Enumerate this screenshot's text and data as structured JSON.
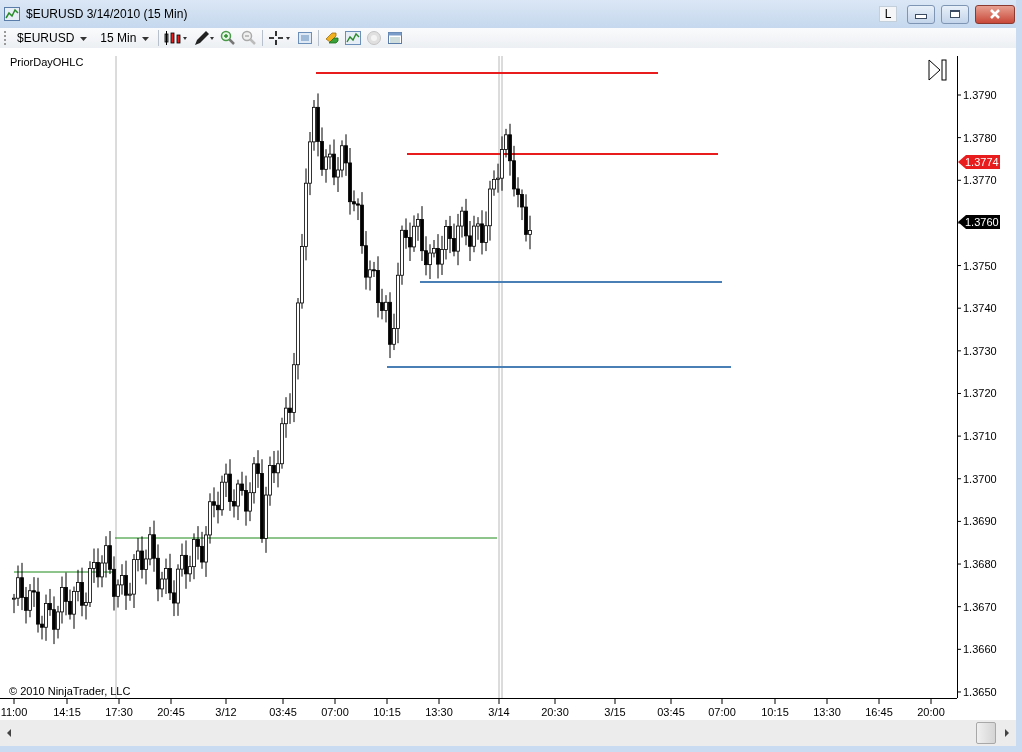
{
  "window": {
    "title": "$EURUSD  3/14/2010 (15 Min)",
    "buttons": [
      "L"
    ]
  },
  "toolbar": {
    "instrument": "$EURUSD",
    "interval": "15 Min"
  },
  "chart": {
    "indicator_label": "PriorDayOHLC",
    "copyright": "© 2010 NinjaTrader, LLC",
    "price_axis": [
      "1.3790",
      "1.3780",
      "1.3770",
      "1.3750",
      "1.3740",
      "1.3730",
      "1.3720",
      "1.3710",
      "1.3700",
      "1.3690",
      "1.3680",
      "1.3670",
      "1.3660",
      "1.3650"
    ],
    "time_axis": [
      "11:00",
      "14:15",
      "17:30",
      "20:45",
      "3/12",
      "03:45",
      "07:00",
      "10:15",
      "13:30",
      "3/14",
      "20:30",
      "3/15",
      "03:45",
      "07:00",
      "10:15",
      "13:30",
      "16:45",
      "20:00"
    ],
    "price_markers": [
      {
        "label": "1.3774",
        "color": "#e81c1c"
      },
      {
        "label": "1.3760",
        "color": "#000000"
      }
    ]
  }
}
